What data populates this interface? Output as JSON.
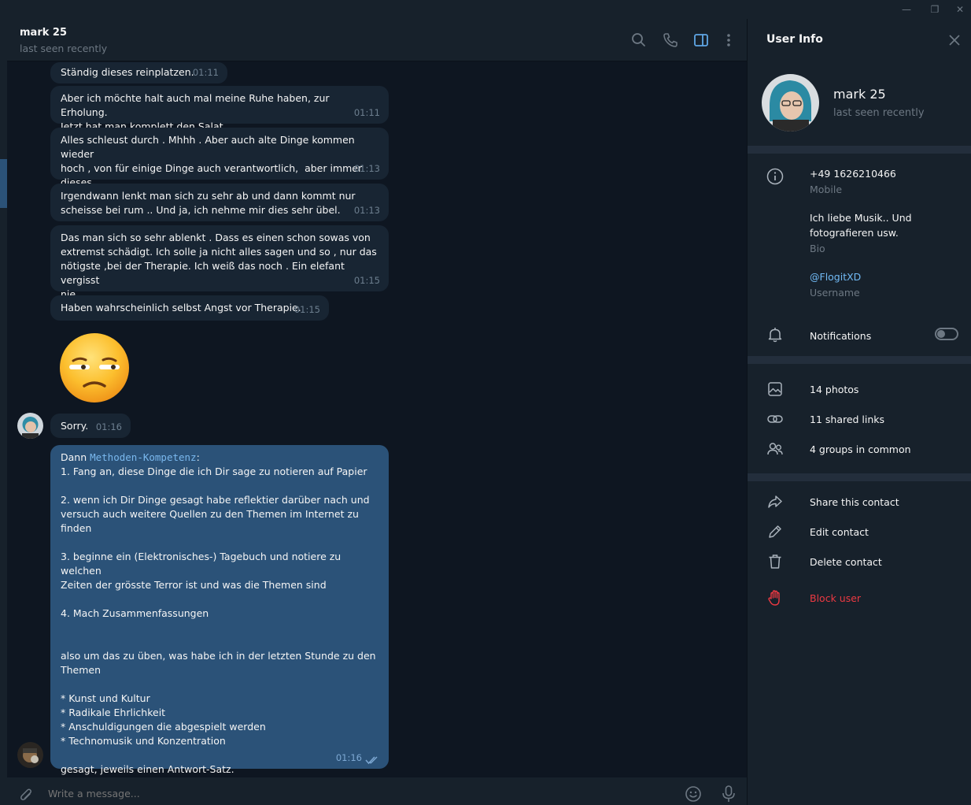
{
  "window": {
    "minimize_glyph": "—",
    "restore_glyph": "❐",
    "close_glyph": "✕"
  },
  "chat_header": {
    "name": "mark 25",
    "status": "last seen recently"
  },
  "messages": [
    {
      "text": "Ständig dieses reinplatzen.",
      "time": "01:11"
    },
    {
      "text": "Aber ich möchte halt auch mal meine Ruhe haben, zur Erholung.\nJetzt hat man komplett den Salat.",
      "time": "01:11"
    },
    {
      "text": "Alles schleust durch . Mhhh . Aber auch alte Dinge kommen wieder\nhoch , von für einige Dinge auch verantwortlich,  aber immer dieses\nGefühl ,schuldgefühle reinhauen ist auch doof.",
      "time": "01:13"
    },
    {
      "text": "Irgendwann lenkt man sich zu sehr ab und dann kommt nur\nscheisse bei rum .. Und ja, ich nehme mir dies sehr übel.",
      "time": "01:13"
    },
    {
      "text": "Das man sich so sehr ablenkt . Dass es einen schon sowas von\nextremst schädigt. Ich solle ja nicht alles sagen und so , nur das\nnötigste ,bei der Therapie. Ich weiß das noch . Ein elefant vergisst\nnie.",
      "time": "01:15"
    },
    {
      "text": "Haben wahrscheinlich selbst Angst vor Therapie.",
      "time": "01:15"
    },
    {
      "text": "Sorry.",
      "time": "01:16"
    }
  ],
  "sticker": {
    "emoji": "😒"
  },
  "outgoing": {
    "prefix": "Dann ",
    "code": "Methoden-Kompetenz",
    "suffix": ":",
    "body": "\n1. Fang an, diese Dinge die ich Dir sage zu notieren auf Papier\n\n2. wenn ich Dir Dinge gesagt habe reflektier darüber nach und\nversuch auch weitere Quellen zu den Themen im Internet zu finden\n\n3. beginne ein (Elektronisches-) Tagebuch und notiere zu welchen\nZeiten der grösste Terror ist und was die Themen sind\n\n4. Mach Zusammenfassungen\n\n\nalso um das zu üben, was habe ich in der letzten Stunde zu den\nThemen\n\n* Kunst und Kultur\n* Radikale Ehrlichkeit\n* Anschuldigungen die abgespielt werden\n* Technomusik und Konzentration\n\ngesagt, jeweils einen Antwort-Satz.",
    "time": "01:16"
  },
  "input": {
    "placeholder": "Write a message..."
  },
  "user_info": {
    "title": "User Info",
    "name": "mark 25",
    "status": "last seen recently",
    "phone": "+49 1626210466",
    "phone_label": "Mobile",
    "bio": "Ich liebe Musik.. Und\nfotografieren usw.",
    "bio_label": "Bio",
    "username": "@FlogitXD",
    "username_label": "Username",
    "notifications": "Notifications",
    "notifications_enabled": false,
    "photos": "14 photos",
    "links": "11 shared links",
    "groups": "4 groups in common",
    "share": "Share this contact",
    "edit": "Edit contact",
    "delete": "Delete contact",
    "block": "Block user"
  },
  "colors": {
    "accent": "#2b5278",
    "link": "#71baf5",
    "danger": "#ec3942",
    "background": "#0e1621"
  }
}
